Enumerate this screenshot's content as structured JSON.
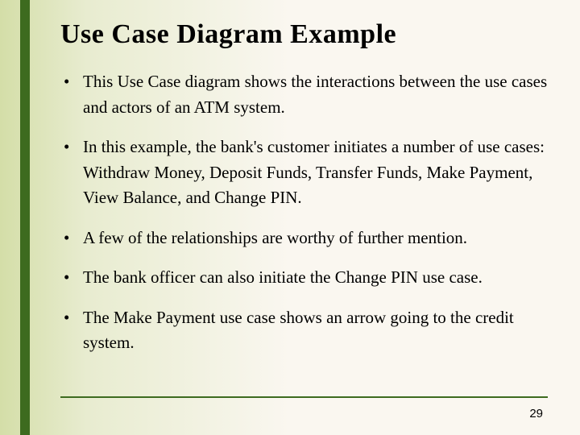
{
  "title": "Use Case Diagram Example",
  "bullets": [
    "This Use Case diagram shows the interactions between the use cases and actors of an ATM system.",
    "In this example, the bank's customer initiates a number of use cases: Withdraw Money, Deposit Funds, Transfer Funds, Make Payment, View Balance, and Change PIN.",
    "A few of the relationships are worthy of further mention.",
    "The bank officer can also initiate the Change PIN use case.",
    "The Make Payment use case shows an arrow going to the credit system."
  ],
  "page_number": "29"
}
